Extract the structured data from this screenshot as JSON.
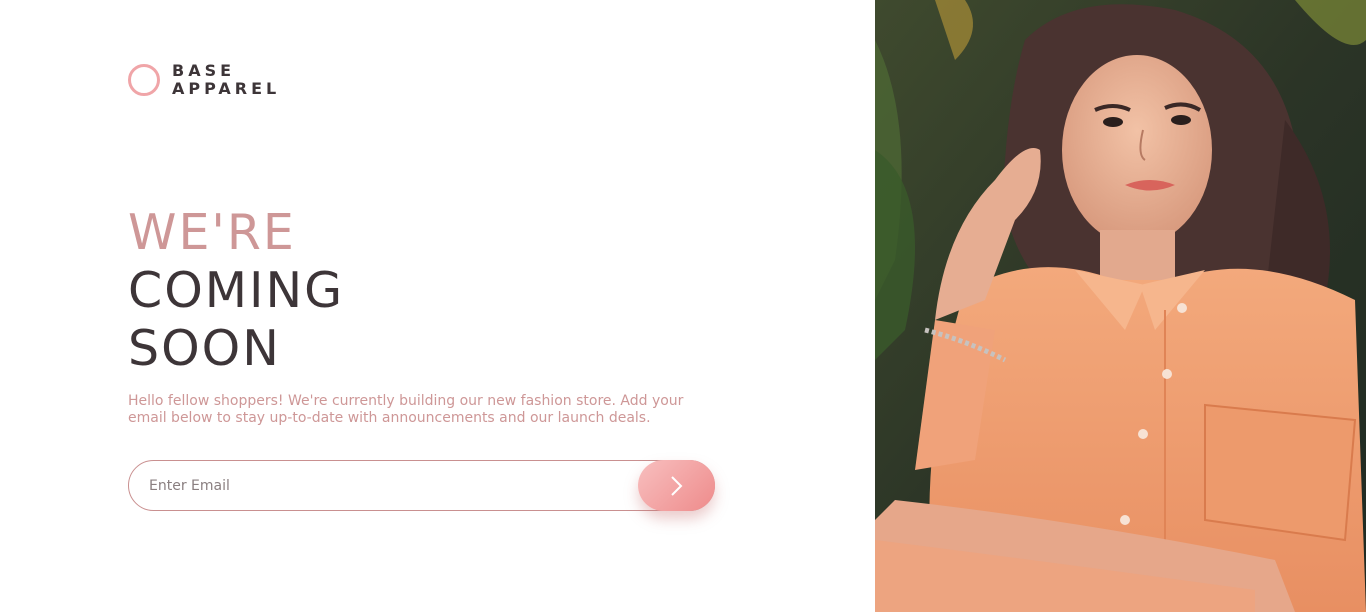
{
  "brand": {
    "line1": "BASE",
    "line2": "APPAREL"
  },
  "headline": {
    "line1": "WE'RE",
    "line2": "COMING",
    "line3": "SOON"
  },
  "description": "Hello fellow shoppers! We're currently building our new fashion store. Add your email below to stay up-to-date with announcements and our launch deals.",
  "form": {
    "email_placeholder": "Enter Email",
    "email_value": "",
    "submit_icon": "chevron-right-icon"
  },
  "colors": {
    "accent": "#ce9797",
    "dark_text": "#3d3538",
    "button_gradient_start": "#f8bfbf",
    "button_gradient_end": "#ee8b8b"
  },
  "hero_image": {
    "subject": "hero-photo"
  }
}
